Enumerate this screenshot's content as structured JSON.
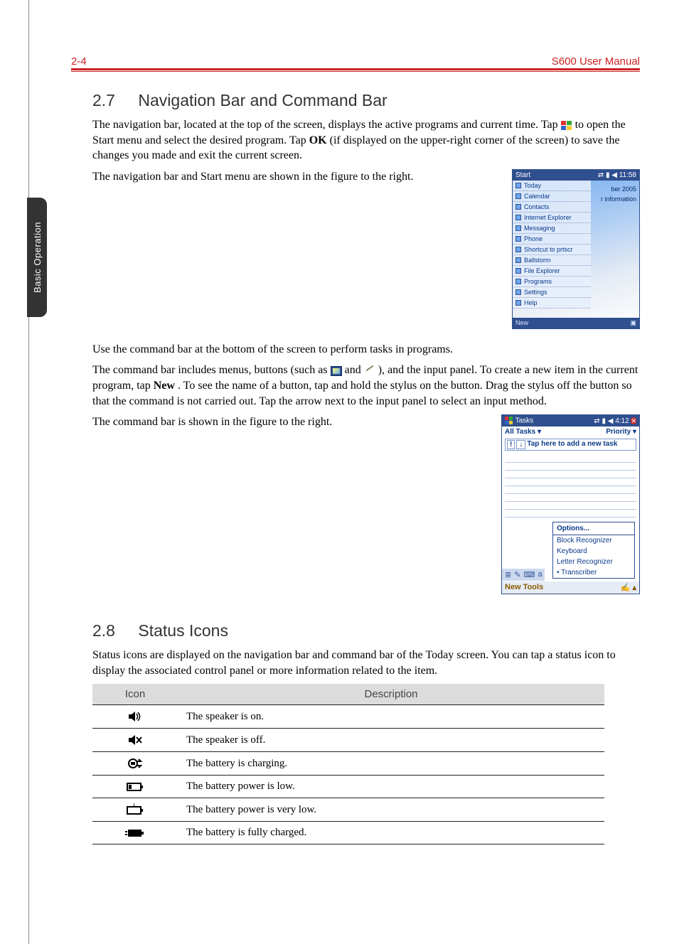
{
  "header": {
    "page_number": "2-4",
    "manual_title": "S600 User Manual"
  },
  "side_tab": "Basic Operation",
  "section27": {
    "number": "2.7",
    "title": "Navigation Bar and Command Bar",
    "para1_pre": "The navigation bar, located at the top of the screen, displays the active programs and current time. Tap ",
    "para1_post": " to open the Start menu and select the desired program. Tap ",
    "ok": "OK",
    "para1_tail": " (if displayed on the upper-right corner of the screen) to save the changes you made and exit the current screen.",
    "para2": "The navigation bar and Start menu are shown in the figure to the right.",
    "para3": "Use the command bar at the bottom of the screen to perform tasks in programs.",
    "para4_a": "The command bar includes menus, buttons (such as ",
    "para4_b": " and ",
    "para4_c": " ), and the input panel. To create a new item in the current program, tap ",
    "new": "New",
    "para4_d": ". To see the name of a button, tap and hold the stylus on the button. Drag the stylus off the button so that the command is not carried out. Tap the arrow next to the input panel to select an input method.",
    "para5": "The command bar is shown in the figure to the right."
  },
  "fig_nav": {
    "start": "Start",
    "time": "11:58",
    "items": [
      "Today",
      "Calendar",
      "Contacts",
      "Internet Explorer",
      "Messaging",
      "Phone",
      "Shortcut to prtscr",
      "Ballstorm",
      "File Explorer",
      "Programs",
      "Settings",
      "Help"
    ],
    "right_top": "ber 2005",
    "right_info": "r information",
    "new": "New"
  },
  "fig_cmd": {
    "title": "Tasks",
    "time": "4:12",
    "all_tasks": "All Tasks ▾",
    "priority": "Priority ▾",
    "warn": "!",
    "sort": "↓",
    "add_prompt": "Tap here to add a new task",
    "options": "Options...",
    "popup_items": [
      "Block Recognizer",
      "Keyboard",
      "Letter Recognizer"
    ],
    "popup_selected": "Transcriber",
    "bottom_left": "New  Tools"
  },
  "section28": {
    "number": "2.8",
    "title": "Status Icons",
    "para1": "Status icons are displayed on the navigation bar and command bar of the Today screen. You can tap a status icon to display the associated control panel or more information related to the item.",
    "table": {
      "head_icon": "Icon",
      "head_desc": "Description",
      "rows": [
        "The speaker is on.",
        "The speaker is off.",
        "The battery is charging.",
        "The battery power is low.",
        "The battery power is very low.",
        "The battery is fully charged."
      ]
    }
  }
}
